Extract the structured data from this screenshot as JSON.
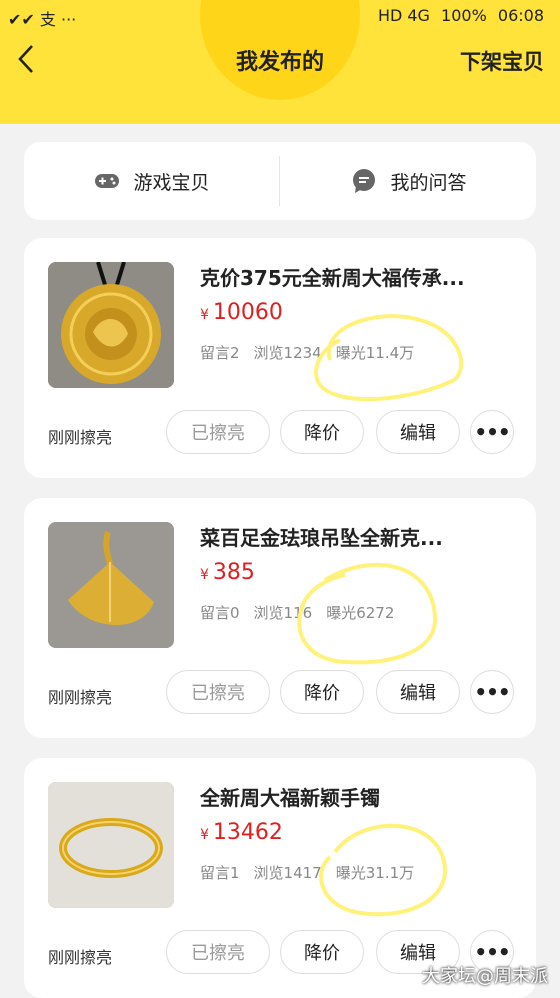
{
  "status_bar": {
    "left_icons": "✔✔ 支 ···",
    "battery": "100%",
    "time": "06:08",
    "network": "HD 4G"
  },
  "nav": {
    "back_icon": "chevron-left-icon",
    "title": "我发布的",
    "action": "下架宝贝"
  },
  "tabs": [
    {
      "label": "游戏宝贝",
      "icon": "gamepad-icon"
    },
    {
      "label": "我的问答",
      "icon": "chat-bubble-icon"
    }
  ],
  "items": [
    {
      "title": "克价375元全新周大福传承...",
      "currency": "¥",
      "price": "10060",
      "comments": "留言2",
      "views": "浏览1234",
      "exposure": "曝光11.4万",
      "status": "刚刚擦亮",
      "btn_polished": "已擦亮",
      "btn_reduce": "降价",
      "btn_edit": "编辑",
      "btn_more": "•••"
    },
    {
      "title": "菜百足金珐琅吊坠全新克...",
      "currency": "¥",
      "price": "385",
      "comments": "留言0",
      "views": "浏览116",
      "exposure": "曝光6272",
      "status": "刚刚擦亮",
      "btn_polished": "已擦亮",
      "btn_reduce": "降价",
      "btn_edit": "编辑",
      "btn_more": "•••"
    },
    {
      "title": "全新周大福新颖手镯",
      "currency": "¥",
      "price": "13462",
      "comments": "留言1",
      "views": "浏览1417",
      "exposure": "曝光31.1万",
      "status": "刚刚擦亮",
      "btn_polished": "已擦亮",
      "btn_reduce": "降价",
      "btn_edit": "编辑",
      "btn_more": "•••"
    }
  ],
  "watermark": "大家坛@周末派",
  "colors": {
    "brand_yellow": "#ffe33a",
    "price_red": "#e02020",
    "highlight_circle": "#fff27a"
  }
}
